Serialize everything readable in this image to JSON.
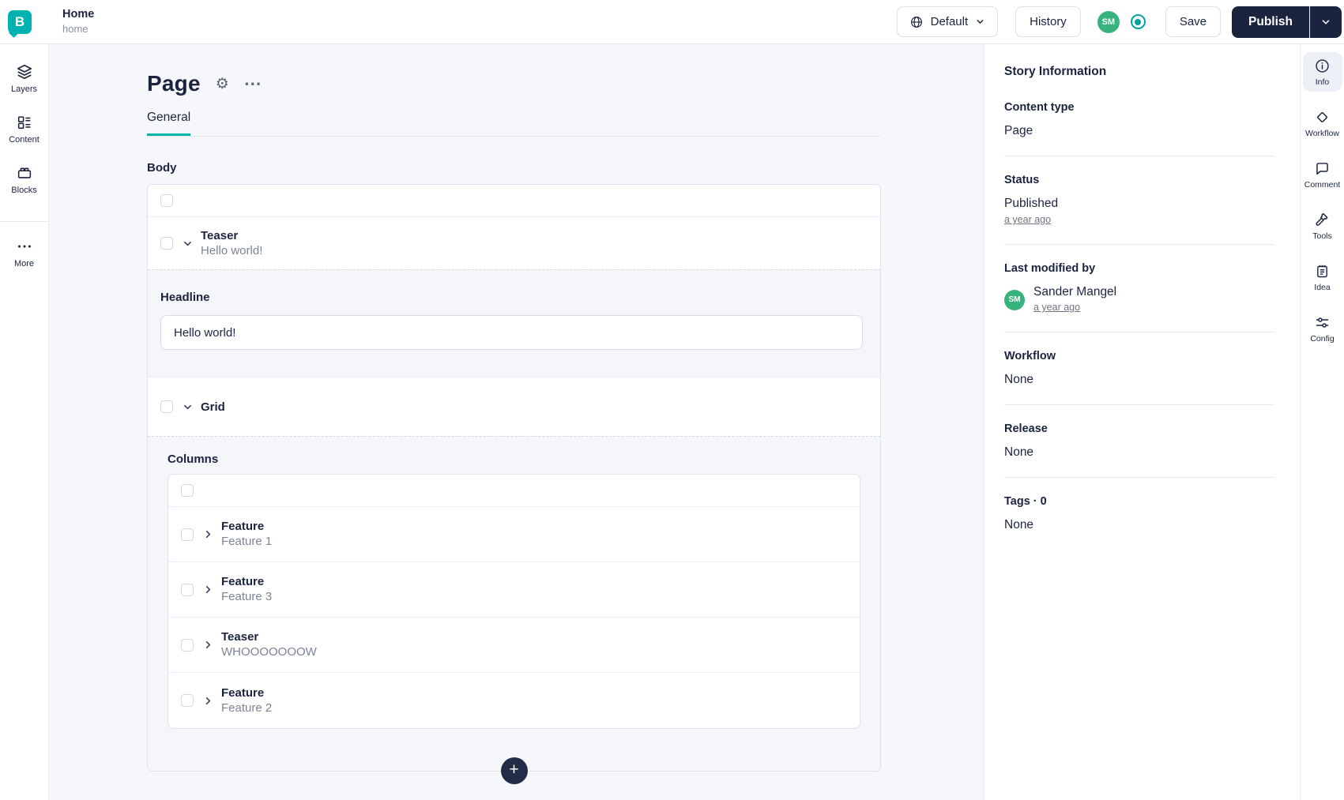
{
  "topbar": {
    "logo_letter": "B",
    "title": "Home",
    "subtitle": "home",
    "language_label": "Default",
    "history_label": "History",
    "avatar_initials": "SM",
    "save_label": "Save",
    "publish_label": "Publish"
  },
  "left_sidebar": {
    "items": [
      {
        "label": "Layers"
      },
      {
        "label": "Content"
      },
      {
        "label": "Blocks"
      },
      {
        "label": "More"
      }
    ]
  },
  "editor": {
    "page_title": "Page",
    "tab_general": "General",
    "body_label": "Body",
    "teaser_block": {
      "title": "Teaser",
      "subtitle": "Hello world!"
    },
    "headline_label": "Headline",
    "headline_value": "Hello world!",
    "grid_block": {
      "title": "Grid"
    },
    "columns_label": "Columns",
    "column_blocks": [
      {
        "title": "Feature",
        "subtitle": "Feature 1"
      },
      {
        "title": "Feature",
        "subtitle": "Feature 3"
      },
      {
        "title": "Teaser",
        "subtitle": "WHOOOOOOOW"
      },
      {
        "title": "Feature",
        "subtitle": "Feature 2"
      }
    ],
    "add_button": "+"
  },
  "story_info": {
    "heading": "Story Information",
    "content_type_label": "Content type",
    "content_type_value": "Page",
    "status_label": "Status",
    "status_value": "Published",
    "status_time": "a year ago",
    "modified_label": "Last modified by",
    "modified_initials": "SM",
    "modified_user": "Sander Mangel",
    "modified_time": "a year ago",
    "workflow_label": "Workflow",
    "workflow_value": "None",
    "release_label": "Release",
    "release_value": "None",
    "tags_label": "Tags · 0",
    "tags_value": "None"
  },
  "right_rail": {
    "items": [
      {
        "label": "Info"
      },
      {
        "label": "Workflow"
      },
      {
        "label": "Comment"
      },
      {
        "label": "Tools"
      },
      {
        "label": "Idea"
      },
      {
        "label": "Config"
      }
    ]
  },
  "icons": {
    "gear": "⚙",
    "ellipsis": "⋯"
  },
  "colors": {
    "brand_teal": "#00b3b0",
    "navy": "#1b243f",
    "avatar_green": "#36b37e",
    "page_background": "#f6f7fb"
  }
}
